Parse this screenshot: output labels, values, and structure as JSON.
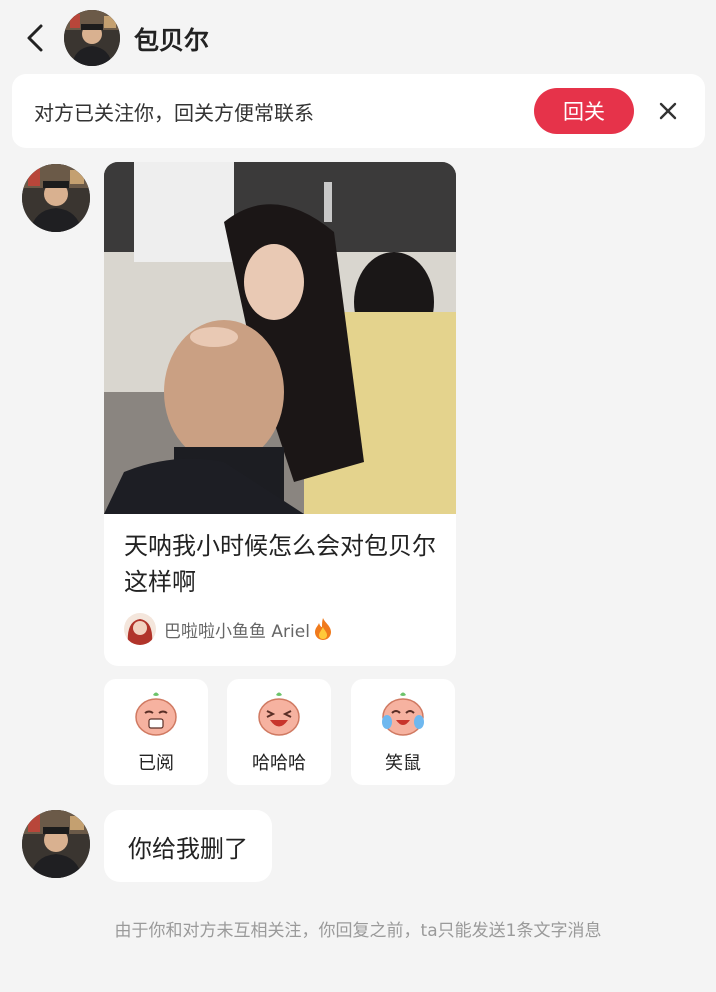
{
  "header": {
    "back_icon": "chevron-left-icon",
    "contact_name": "包贝尔"
  },
  "follow_bar": {
    "message": "对方已关注你，回关方便常联系",
    "follow_back_label": "回关",
    "close_icon": "close-icon",
    "accent_color": "#e6334a"
  },
  "shared_post": {
    "title": "天呐我小时候怎么会对包贝尔这样啊",
    "author_name": "巴啦啦小鱼鱼 Ariel",
    "author_badge_icon": "fire-icon"
  },
  "reactions": [
    {
      "label": "已阅",
      "icon": "read-emoji-icon"
    },
    {
      "label": "哈哈哈",
      "icon": "laugh-emoji-icon"
    },
    {
      "label": "笑鼠",
      "icon": "laugh-cry-emoji-icon"
    }
  ],
  "messages": [
    {
      "text": "你给我删了"
    }
  ],
  "system_note": "由于你和对方未互相关注，你回复之前，ta只能发送1条文字消息"
}
